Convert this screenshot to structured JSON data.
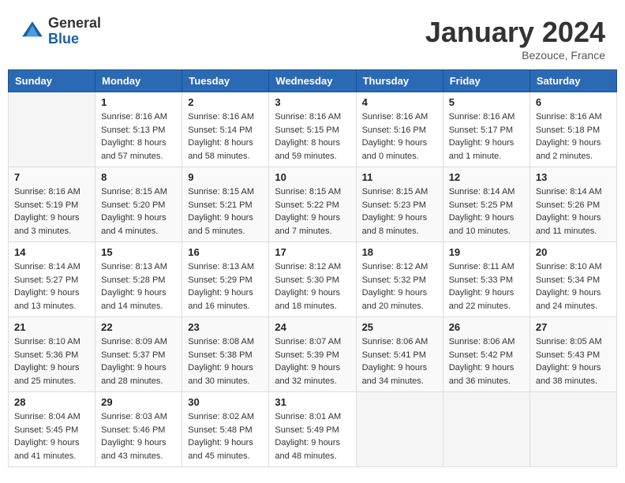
{
  "header": {
    "logo_general": "General",
    "logo_blue": "Blue",
    "month_title": "January 2024",
    "location": "Bezouce, France"
  },
  "days_of_week": [
    "Sunday",
    "Monday",
    "Tuesday",
    "Wednesday",
    "Thursday",
    "Friday",
    "Saturday"
  ],
  "weeks": [
    [
      {
        "day": "",
        "sunrise": "",
        "sunset": "",
        "daylight": ""
      },
      {
        "day": "1",
        "sunrise": "Sunrise: 8:16 AM",
        "sunset": "Sunset: 5:13 PM",
        "daylight": "Daylight: 8 hours and 57 minutes."
      },
      {
        "day": "2",
        "sunrise": "Sunrise: 8:16 AM",
        "sunset": "Sunset: 5:14 PM",
        "daylight": "Daylight: 8 hours and 58 minutes."
      },
      {
        "day": "3",
        "sunrise": "Sunrise: 8:16 AM",
        "sunset": "Sunset: 5:15 PM",
        "daylight": "Daylight: 8 hours and 59 minutes."
      },
      {
        "day": "4",
        "sunrise": "Sunrise: 8:16 AM",
        "sunset": "Sunset: 5:16 PM",
        "daylight": "Daylight: 9 hours and 0 minutes."
      },
      {
        "day": "5",
        "sunrise": "Sunrise: 8:16 AM",
        "sunset": "Sunset: 5:17 PM",
        "daylight": "Daylight: 9 hours and 1 minute."
      },
      {
        "day": "6",
        "sunrise": "Sunrise: 8:16 AM",
        "sunset": "Sunset: 5:18 PM",
        "daylight": "Daylight: 9 hours and 2 minutes."
      }
    ],
    [
      {
        "day": "7",
        "sunrise": "Sunrise: 8:16 AM",
        "sunset": "Sunset: 5:19 PM",
        "daylight": "Daylight: 9 hours and 3 minutes."
      },
      {
        "day": "8",
        "sunrise": "Sunrise: 8:15 AM",
        "sunset": "Sunset: 5:20 PM",
        "daylight": "Daylight: 9 hours and 4 minutes."
      },
      {
        "day": "9",
        "sunrise": "Sunrise: 8:15 AM",
        "sunset": "Sunset: 5:21 PM",
        "daylight": "Daylight: 9 hours and 5 minutes."
      },
      {
        "day": "10",
        "sunrise": "Sunrise: 8:15 AM",
        "sunset": "Sunset: 5:22 PM",
        "daylight": "Daylight: 9 hours and 7 minutes."
      },
      {
        "day": "11",
        "sunrise": "Sunrise: 8:15 AM",
        "sunset": "Sunset: 5:23 PM",
        "daylight": "Daylight: 9 hours and 8 minutes."
      },
      {
        "day": "12",
        "sunrise": "Sunrise: 8:14 AM",
        "sunset": "Sunset: 5:25 PM",
        "daylight": "Daylight: 9 hours and 10 minutes."
      },
      {
        "day": "13",
        "sunrise": "Sunrise: 8:14 AM",
        "sunset": "Sunset: 5:26 PM",
        "daylight": "Daylight: 9 hours and 11 minutes."
      }
    ],
    [
      {
        "day": "14",
        "sunrise": "Sunrise: 8:14 AM",
        "sunset": "Sunset: 5:27 PM",
        "daylight": "Daylight: 9 hours and 13 minutes."
      },
      {
        "day": "15",
        "sunrise": "Sunrise: 8:13 AM",
        "sunset": "Sunset: 5:28 PM",
        "daylight": "Daylight: 9 hours and 14 minutes."
      },
      {
        "day": "16",
        "sunrise": "Sunrise: 8:13 AM",
        "sunset": "Sunset: 5:29 PM",
        "daylight": "Daylight: 9 hours and 16 minutes."
      },
      {
        "day": "17",
        "sunrise": "Sunrise: 8:12 AM",
        "sunset": "Sunset: 5:30 PM",
        "daylight": "Daylight: 9 hours and 18 minutes."
      },
      {
        "day": "18",
        "sunrise": "Sunrise: 8:12 AM",
        "sunset": "Sunset: 5:32 PM",
        "daylight": "Daylight: 9 hours and 20 minutes."
      },
      {
        "day": "19",
        "sunrise": "Sunrise: 8:11 AM",
        "sunset": "Sunset: 5:33 PM",
        "daylight": "Daylight: 9 hours and 22 minutes."
      },
      {
        "day": "20",
        "sunrise": "Sunrise: 8:10 AM",
        "sunset": "Sunset: 5:34 PM",
        "daylight": "Daylight: 9 hours and 24 minutes."
      }
    ],
    [
      {
        "day": "21",
        "sunrise": "Sunrise: 8:10 AM",
        "sunset": "Sunset: 5:36 PM",
        "daylight": "Daylight: 9 hours and 25 minutes."
      },
      {
        "day": "22",
        "sunrise": "Sunrise: 8:09 AM",
        "sunset": "Sunset: 5:37 PM",
        "daylight": "Daylight: 9 hours and 28 minutes."
      },
      {
        "day": "23",
        "sunrise": "Sunrise: 8:08 AM",
        "sunset": "Sunset: 5:38 PM",
        "daylight": "Daylight: 9 hours and 30 minutes."
      },
      {
        "day": "24",
        "sunrise": "Sunrise: 8:07 AM",
        "sunset": "Sunset: 5:39 PM",
        "daylight": "Daylight: 9 hours and 32 minutes."
      },
      {
        "day": "25",
        "sunrise": "Sunrise: 8:06 AM",
        "sunset": "Sunset: 5:41 PM",
        "daylight": "Daylight: 9 hours and 34 minutes."
      },
      {
        "day": "26",
        "sunrise": "Sunrise: 8:06 AM",
        "sunset": "Sunset: 5:42 PM",
        "daylight": "Daylight: 9 hours and 36 minutes."
      },
      {
        "day": "27",
        "sunrise": "Sunrise: 8:05 AM",
        "sunset": "Sunset: 5:43 PM",
        "daylight": "Daylight: 9 hours and 38 minutes."
      }
    ],
    [
      {
        "day": "28",
        "sunrise": "Sunrise: 8:04 AM",
        "sunset": "Sunset: 5:45 PM",
        "daylight": "Daylight: 9 hours and 41 minutes."
      },
      {
        "day": "29",
        "sunrise": "Sunrise: 8:03 AM",
        "sunset": "Sunset: 5:46 PM",
        "daylight": "Daylight: 9 hours and 43 minutes."
      },
      {
        "day": "30",
        "sunrise": "Sunrise: 8:02 AM",
        "sunset": "Sunset: 5:48 PM",
        "daylight": "Daylight: 9 hours and 45 minutes."
      },
      {
        "day": "31",
        "sunrise": "Sunrise: 8:01 AM",
        "sunset": "Sunset: 5:49 PM",
        "daylight": "Daylight: 9 hours and 48 minutes."
      },
      {
        "day": "",
        "sunrise": "",
        "sunset": "",
        "daylight": ""
      },
      {
        "day": "",
        "sunrise": "",
        "sunset": "",
        "daylight": ""
      },
      {
        "day": "",
        "sunrise": "",
        "sunset": "",
        "daylight": ""
      }
    ]
  ]
}
